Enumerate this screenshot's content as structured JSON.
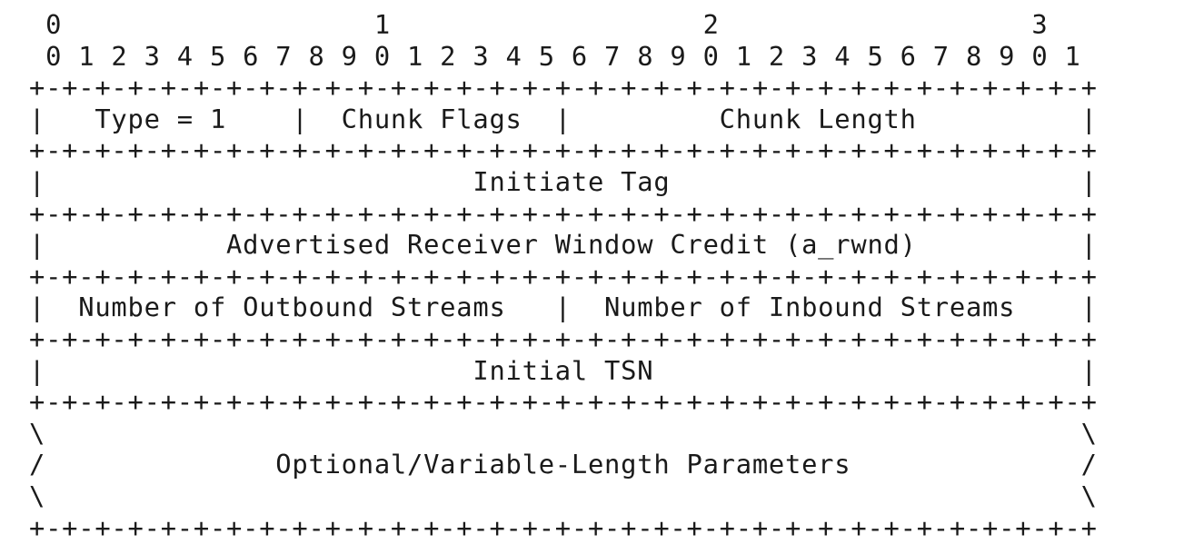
{
  "lines": [
    {
      "text": " 0                   1                   2                   3",
      "kind": "ruler-tens"
    },
    {
      "text": " 0 1 2 3 4 5 6 7 8 9 0 1 2 3 4 5 6 7 8 9 0 1 2 3 4 5 6 7 8 9 0 1",
      "kind": "ruler-units"
    },
    {
      "text": "+-+-+-+-+-+-+-+-+-+-+-+-+-+-+-+-+-+-+-+-+-+-+-+-+-+-+-+-+-+-+-+-+",
      "kind": "border"
    },
    {
      "text": "|   Type = 1    |  Chunk Flags  |         Chunk Length          |",
      "kind": "field-row"
    },
    {
      "text": "+-+-+-+-+-+-+-+-+-+-+-+-+-+-+-+-+-+-+-+-+-+-+-+-+-+-+-+-+-+-+-+-+",
      "kind": "border"
    },
    {
      "text": "|                          Initiate Tag                         |",
      "kind": "field-row"
    },
    {
      "text": "+-+-+-+-+-+-+-+-+-+-+-+-+-+-+-+-+-+-+-+-+-+-+-+-+-+-+-+-+-+-+-+-+",
      "kind": "border"
    },
    {
      "text": "|           Advertised Receiver Window Credit (a_rwnd)          |",
      "kind": "field-row"
    },
    {
      "text": "+-+-+-+-+-+-+-+-+-+-+-+-+-+-+-+-+-+-+-+-+-+-+-+-+-+-+-+-+-+-+-+-+",
      "kind": "border"
    },
    {
      "text": "|  Number of Outbound Streams   |  Number of Inbound Streams    |",
      "kind": "field-row"
    },
    {
      "text": "+-+-+-+-+-+-+-+-+-+-+-+-+-+-+-+-+-+-+-+-+-+-+-+-+-+-+-+-+-+-+-+-+",
      "kind": "border"
    },
    {
      "text": "|                          Initial TSN                          |",
      "kind": "field-row"
    },
    {
      "text": "+-+-+-+-+-+-+-+-+-+-+-+-+-+-+-+-+-+-+-+-+-+-+-+-+-+-+-+-+-+-+-+-+",
      "kind": "border"
    },
    {
      "text": "\\                                                               \\",
      "kind": "variable-edge"
    },
    {
      "text": "/              Optional/Variable-Length Parameters              /",
      "kind": "field-row"
    },
    {
      "text": "\\                                                               \\",
      "kind": "variable-edge"
    },
    {
      "text": "+-+-+-+-+-+-+-+-+-+-+-+-+-+-+-+-+-+-+-+-+-+-+-+-+-+-+-+-+-+-+-+-+",
      "kind": "border"
    }
  ]
}
